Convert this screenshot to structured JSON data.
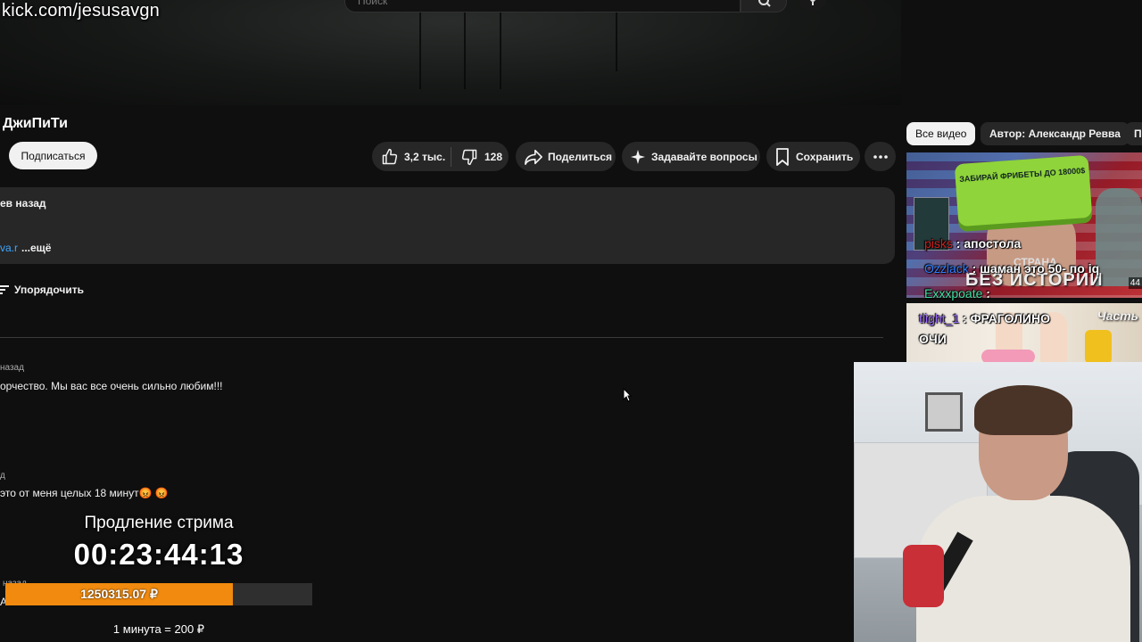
{
  "overlay": {
    "stream_url": "kick.com/jesusavgn",
    "extension": {
      "title": "Продление стрима",
      "timer": "00:23:44:13",
      "amount": "1250315.07 ₽",
      "progress": 0.74,
      "rate": "1 минута = 200 ₽"
    }
  },
  "header": {
    "search_placeholder": "Поиск"
  },
  "channel": {
    "name": "ДжиПиТи",
    "subscribe_label": "Подписаться"
  },
  "actions": {
    "likes": "3,2 тыс.",
    "dislikes": "128",
    "share_label": "Поделиться",
    "ask_label": "Задавайте вопросы",
    "save_label": "Сохранить"
  },
  "description": {
    "date": "ев назад",
    "link_fragment": "va.r",
    "more_label": "...ещё"
  },
  "comments": {
    "sort_label": "Упорядочить",
    "items": [
      {
        "time": "назад",
        "text": "орчество. Мы вас все очень сильно любим!!!"
      },
      {
        "time": "д",
        "text": "это от меня целых 18 минут😡 😡"
      },
      {
        "time": "назад",
        "text": "А"
      }
    ]
  },
  "sidebar": {
    "chips": [
      "Все видео",
      "Автор: Александр Ревва",
      "По"
    ],
    "video1": {
      "box_text": "ЗАБИРАЙ ФРИБЕТЫ ДО 18000$",
      "caption": "БЕЗ ИСТОРИИ",
      "caption_top": "СТРАНА",
      "duration": "44"
    },
    "video2": {
      "caption": "Часть"
    }
  },
  "chat": [
    {
      "user": "pisks",
      "message": "апостола",
      "color": "#d11f1f"
    },
    {
      "user": "Ozzlack",
      "message": "шаман это 50- по iq",
      "color": "#2f7fff"
    },
    {
      "user": "Exxxpoate",
      "message": "",
      "color": "#3fe0a0"
    },
    {
      "user": "tlight_1",
      "message": "ФРАГОЛИНО ОЧИ",
      "color": "#9d6bff"
    }
  ]
}
